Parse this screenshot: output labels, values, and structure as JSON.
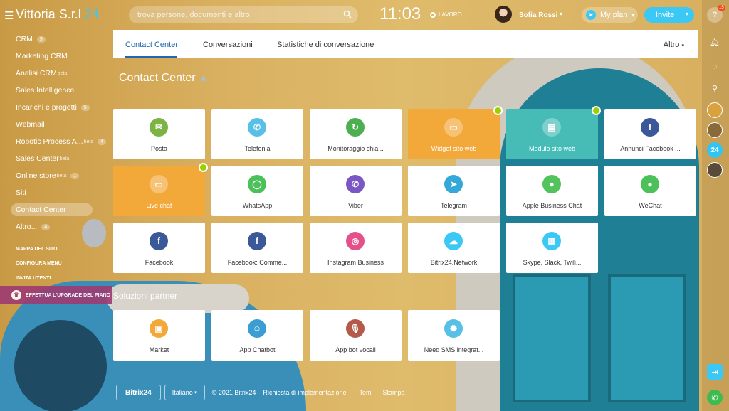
{
  "topbar": {
    "company": "Vittoria S.r.l",
    "company_suffix": "24",
    "search_placeholder": "trova persone, documenti e altro",
    "clock": "11:03",
    "work_status": "LAVORO",
    "user_name": "Sofia Rossi",
    "myplan_label": "My plan",
    "invite_label": "Invite"
  },
  "rightbar": {
    "notif_count": "15",
    "counter_label": "24"
  },
  "sidebar": {
    "items": [
      {
        "label": "CRM",
        "badge": "9"
      },
      {
        "label": "Marketing CRM"
      },
      {
        "label": "Analisi CRM",
        "tag": "beta"
      },
      {
        "label": "Sales Intelligence"
      },
      {
        "label": "Incarichi e progetti",
        "badge": "5"
      },
      {
        "label": "Webmail"
      },
      {
        "label": "Robotic Process A...",
        "tag": "beta",
        "badge": "4"
      },
      {
        "label": "Sales Center",
        "tag": "beta"
      },
      {
        "label": "Online store",
        "tag": "beta",
        "badge": "1"
      },
      {
        "label": "Siti"
      },
      {
        "label": "Contact Center"
      },
      {
        "label": "Altro...",
        "badge": "4"
      }
    ],
    "sitemap": "MAPPA DEL SITO",
    "configure": "CONFIGURA MENU",
    "invite_users": "INVITA UTENTI",
    "upgrade": "EFFETTUA L'UPGRADE DEL PIANO"
  },
  "tabs": {
    "items": [
      "Contact Center",
      "Conversazioni",
      "Statistiche di conversazione"
    ],
    "more": "Altro"
  },
  "page": {
    "title": "Contact Center",
    "partner_title": "Soluzioni partner"
  },
  "tiles": [
    {
      "label": "Posta",
      "icon": "mail-icon",
      "color": "#7cb342"
    },
    {
      "label": "Telefonia",
      "icon": "phone-icon",
      "color": "#58bfe6"
    },
    {
      "label": "Monitoraggio chia...",
      "icon": "call-tracking-icon",
      "color": "#4caf50"
    },
    {
      "label": "Widget sito web",
      "icon": "chat-widget-icon",
      "color": "#f3a83a"
    },
    {
      "label": "Modulo sito web",
      "icon": "web-form-icon",
      "color": "#47bcb7"
    },
    {
      "label": "Annunci Facebook ...",
      "icon": "facebook-ads-icon",
      "color": "#3b5998"
    },
    {
      "label": "Live chat",
      "icon": "live-chat-icon",
      "color": "#f3a83a"
    },
    {
      "label": "WhatsApp",
      "icon": "whatsapp-icon",
      "color": "#4cc15a"
    },
    {
      "label": "Viber",
      "icon": "viber-icon",
      "color": "#7b57c4"
    },
    {
      "label": "Telegram",
      "icon": "telegram-icon",
      "color": "#34a8d9"
    },
    {
      "label": "Apple Business Chat",
      "icon": "apple-chat-icon",
      "color": "#52c35d"
    },
    {
      "label": "WeChat",
      "icon": "wechat-icon",
      "color": "#4cc15a"
    },
    {
      "label": "Facebook",
      "icon": "facebook-icon",
      "color": "#3b5998"
    },
    {
      "label": "Facebook: Comme...",
      "icon": "facebook-comments-icon",
      "color": "#3b5998"
    },
    {
      "label": "Instagram Business",
      "icon": "instagram-icon",
      "color": "#e4508a"
    },
    {
      "label": "Bitrix24.Network",
      "icon": "network-icon",
      "color": "#3bc8f5"
    },
    {
      "label": "Skype, Slack, Twili...",
      "icon": "apps-grid-icon",
      "color": "#3bc8f5"
    }
  ],
  "partner_tiles": [
    {
      "label": "Market",
      "icon": "market-icon",
      "color": "#f3a83a"
    },
    {
      "label": "App Chatbot",
      "icon": "chatbot-icon",
      "color": "#3b9dd4"
    },
    {
      "label": "App bot vocali",
      "icon": "microphone-icon",
      "color": "#b35a4a"
    },
    {
      "label": "Need SMS integrat...",
      "icon": "lightbulb-icon",
      "color": "#58bfe6"
    }
  ],
  "footer": {
    "logo": "Bitrix24",
    "language": "Italiano",
    "copyright": "© 2021 Bitrix24",
    "implementation": "Richiesta di implementazione",
    "themes": "Temi",
    "print": "Stampa"
  }
}
